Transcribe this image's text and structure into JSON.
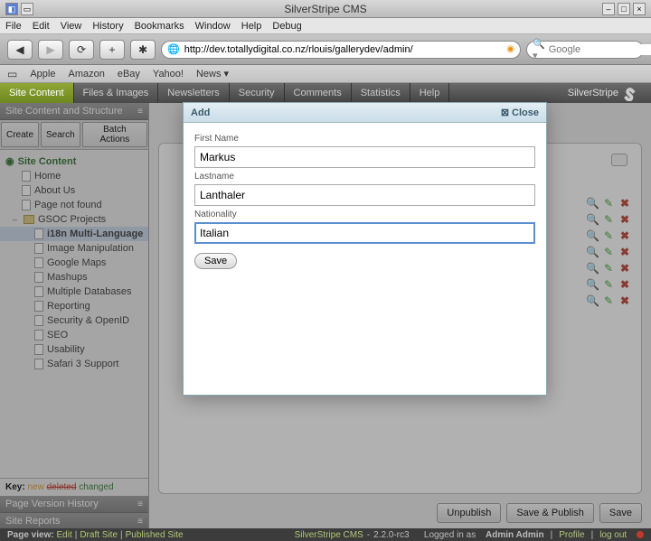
{
  "window": {
    "title": "SilverStripe CMS"
  },
  "menubar": [
    "File",
    "Edit",
    "View",
    "History",
    "Bookmarks",
    "Window",
    "Help",
    "Debug"
  ],
  "toolbar": {
    "url": "http://dev.totallydigital.co.nz/rlouis/gallerydev/admin/",
    "search_placeholder": "Google"
  },
  "bookmarks": [
    "Apple",
    "Amazon",
    "eBay",
    "Yahoo!",
    "News"
  ],
  "tabs": {
    "items": [
      "Site Content",
      "Files & Images",
      "Newsletters",
      "Security",
      "Comments",
      "Statistics",
      "Help"
    ],
    "brand": "SilverStripe"
  },
  "sidebar": {
    "header": "Site Content and Structure",
    "actions": {
      "create": "Create",
      "search": "Search",
      "batch": "Batch Actions"
    },
    "root": "Site Content",
    "items": [
      "Home",
      "About Us",
      "Page not found"
    ],
    "folder": "GSOC Projects",
    "subitems": [
      "i18n Multi-Language",
      "Image Manipulation",
      "Google Maps",
      "Mashups",
      "Multiple Databases",
      "Reporting",
      "Security & OpenID",
      "SEO",
      "Usability",
      "Safari 3 Support"
    ],
    "key": {
      "label": "Key:",
      "new": "new",
      "deleted": "deleted",
      "changed": "changed"
    },
    "phist": "Page Version History",
    "reports": "Site Reports"
  },
  "actions": {
    "unpublish": "Unpublish",
    "savepub": "Save & Publish",
    "save": "Save"
  },
  "modal": {
    "title": "Add",
    "close": "Close",
    "fn_label": "First Name",
    "fn_value": "Markus",
    "ln_label": "Lastname",
    "ln_value": "Lanthaler",
    "nat_label": "Nationality",
    "nat_value": "Italian",
    "save": "Save"
  },
  "footer": {
    "pv": "Page view:",
    "edit": "Edit",
    "draft": "Draft Site",
    "pub": "Published Site",
    "cms": "SilverStripe CMS",
    "ver": "2.2.0-rc3",
    "logged": "Logged in as",
    "user": "Admin Admin",
    "profile": "Profile",
    "logout": "log out"
  }
}
